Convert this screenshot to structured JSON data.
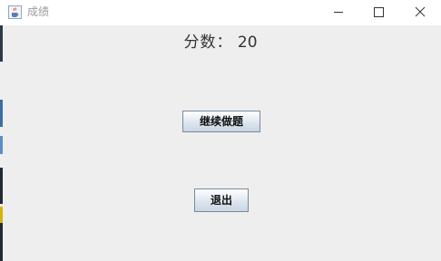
{
  "window": {
    "title": "成绩",
    "icon": "java-cup-icon",
    "controls": [
      "minimize-icon",
      "maximize-icon",
      "close-icon"
    ]
  },
  "score": {
    "label": "分数：",
    "value": "20"
  },
  "buttons": {
    "continue_label": "继续做题",
    "exit_label": "退出"
  }
}
